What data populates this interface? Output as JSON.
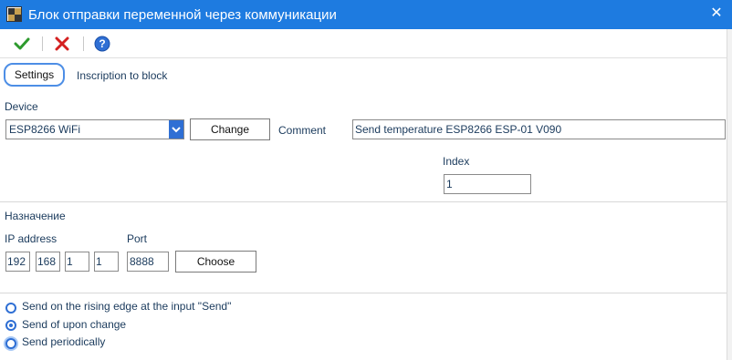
{
  "window": {
    "title": "Блок отправки переменной через коммуникации"
  },
  "toolbar": {
    "buttons": [
      "ok-icon",
      "cancel-icon",
      "help-icon"
    ]
  },
  "tabs": [
    {
      "label": "Settings"
    },
    {
      "label": "Inscription to block"
    }
  ],
  "device": {
    "label": "Device",
    "selected": "ESP8266 WiFi",
    "change_label": "Change",
    "comment_label": "Comment",
    "comment_value": "Send temperature ESP8266 ESP-01 V090",
    "index_label": "Index",
    "index_value": "1"
  },
  "destination": {
    "heading": "Назначение",
    "ip_label": "IP address",
    "ip": [
      "192",
      "168",
      "1",
      "1"
    ],
    "port_label": "Port",
    "port_value": "8888",
    "choose_label": "Choose"
  },
  "send_mode": {
    "options": [
      {
        "label": "Send on the rising edge at the input \"Send\"",
        "checked": false
      },
      {
        "label": "Send of upon change",
        "checked": true
      },
      {
        "label": "Send periodically",
        "checked": false
      }
    ]
  },
  "colors": {
    "title_bar": "#1e7be0",
    "accent": "#2f6fd4",
    "text": "#1a3a5c"
  }
}
